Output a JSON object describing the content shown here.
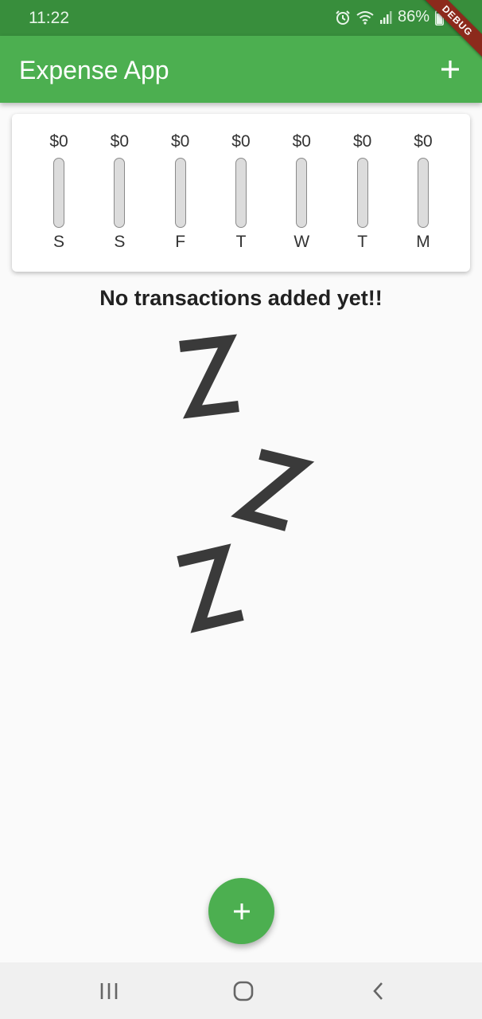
{
  "status_bar": {
    "time": "11:22",
    "battery": "86%",
    "icons": [
      "alarm-icon",
      "wifi-icon",
      "signal-icon",
      "battery-icon"
    ]
  },
  "debug_banner": {
    "label": "DEBUG"
  },
  "app_bar": {
    "title": "Expense App",
    "add_icon": "plus-icon",
    "color": "#4caf50"
  },
  "chart": {
    "bars": [
      {
        "day": "S",
        "amount": "$0",
        "fill": 0
      },
      {
        "day": "S",
        "amount": "$0",
        "fill": 0
      },
      {
        "day": "F",
        "amount": "$0",
        "fill": 0
      },
      {
        "day": "T",
        "amount": "$0",
        "fill": 0
      },
      {
        "day": "W",
        "amount": "$0",
        "fill": 0
      },
      {
        "day": "T",
        "amount": "$0",
        "fill": 0
      },
      {
        "day": "M",
        "amount": "$0",
        "fill": 0
      }
    ]
  },
  "empty_state": {
    "message": "No transactions added yet!!",
    "image": "zzz-sleeping-illustration"
  },
  "fab": {
    "icon": "plus-icon",
    "color": "#4caf50"
  },
  "nav_bar": {
    "buttons": [
      "recent-apps-icon",
      "home-icon",
      "back-icon"
    ]
  },
  "colors": {
    "status_bar": "#388e3c",
    "primary": "#4caf50",
    "background": "#fafafa"
  }
}
